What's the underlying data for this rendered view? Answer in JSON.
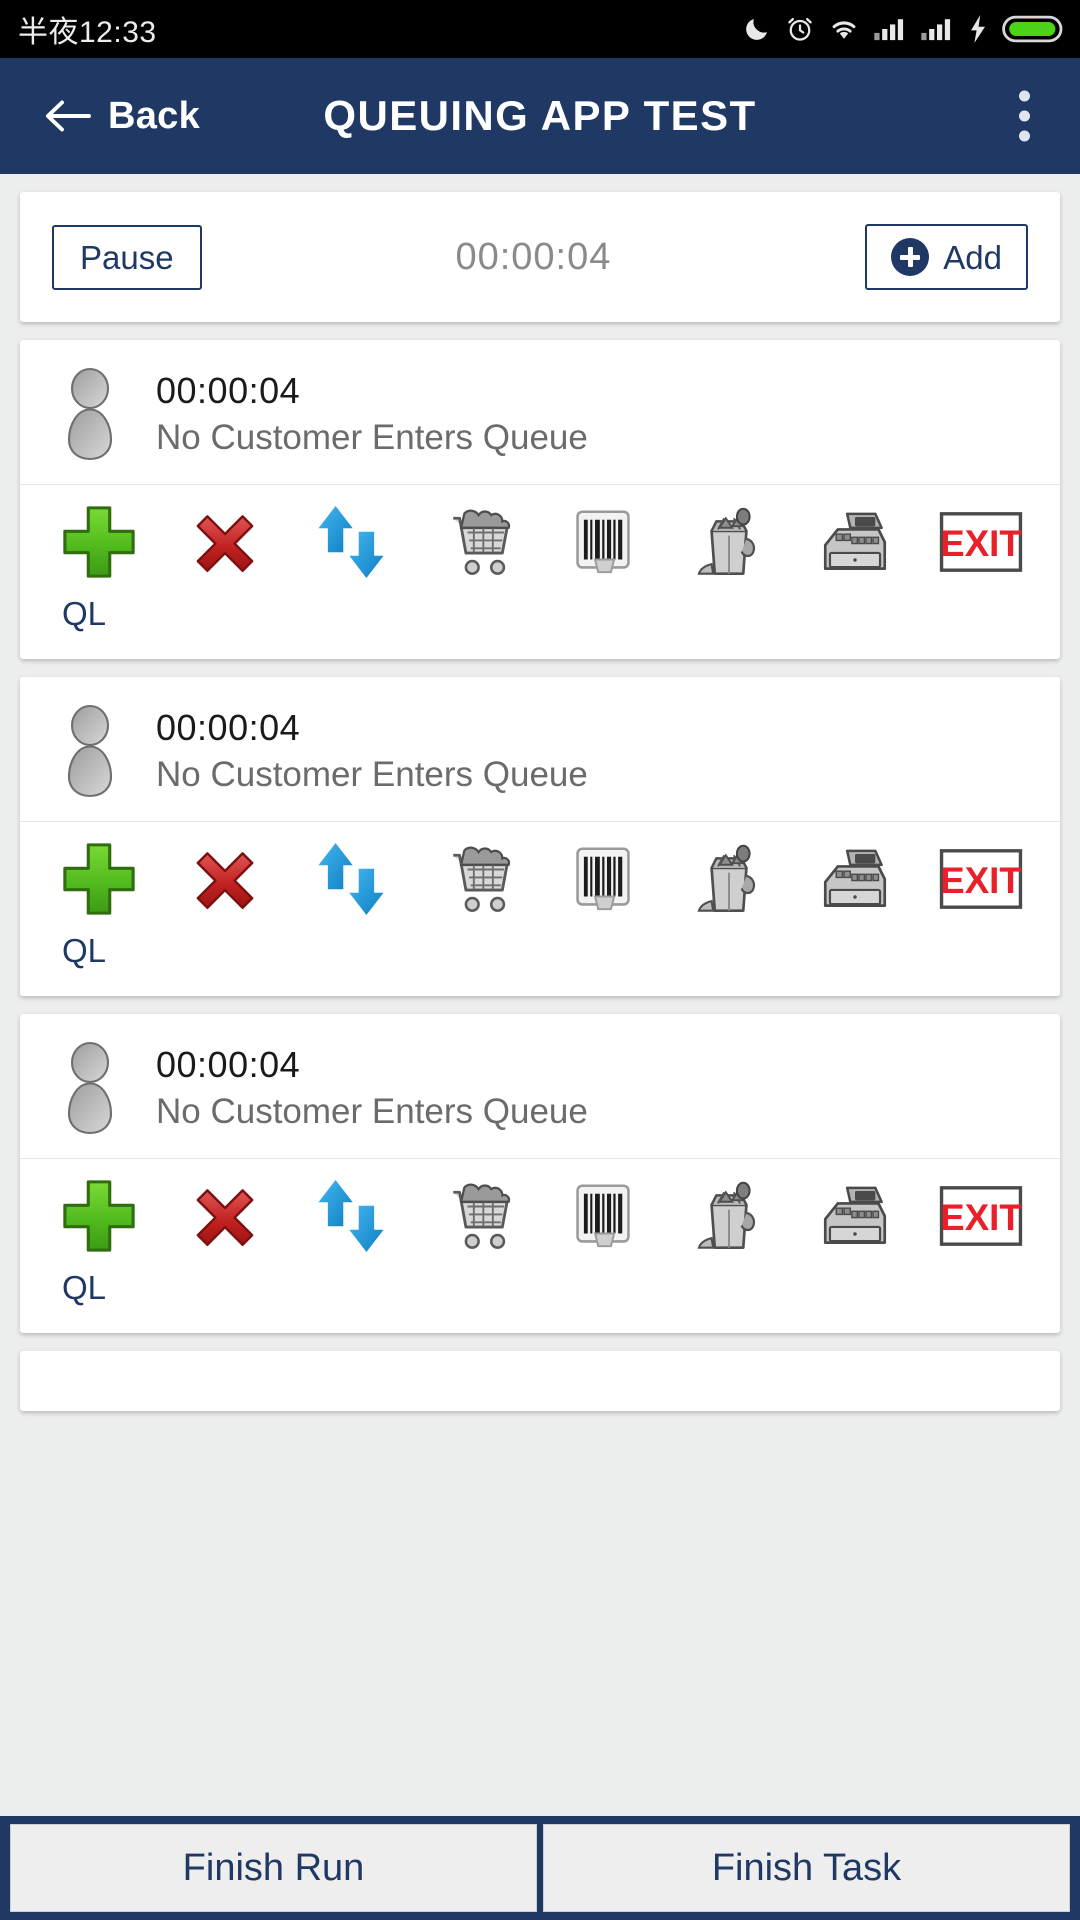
{
  "status_bar": {
    "time": "半夜12:33",
    "icons": [
      "moon-icon",
      "alarm-icon",
      "wifi-icon",
      "signal-icon",
      "signal-icon",
      "charging-bolt-icon",
      "battery-icon"
    ]
  },
  "app_bar": {
    "back_label": "Back",
    "title": "QUEUING APP TEST",
    "overflow_name": "more-options"
  },
  "control_bar": {
    "pause_label": "Pause",
    "timer": "00:00:04",
    "add_label": "Add"
  },
  "queue_cards": [
    {
      "time": "00:00:04",
      "status": "No Customer Enters Queue",
      "ql_label": "QL"
    },
    {
      "time": "00:00:04",
      "status": "No Customer Enters Queue",
      "ql_label": "QL"
    },
    {
      "time": "00:00:04",
      "status": "No Customer Enters Queue",
      "ql_label": "QL"
    }
  ],
  "action_icons": [
    {
      "name": "green-plus-icon",
      "label": "Add Customer"
    },
    {
      "name": "red-x-icon",
      "label": "Remove Customer"
    },
    {
      "name": "blue-up-down-arrows-icon",
      "label": "Swap"
    },
    {
      "name": "shopping-cart-icon",
      "label": "Cart"
    },
    {
      "name": "barcode-icon",
      "label": "Scan"
    },
    {
      "name": "grocery-bag-icon",
      "label": "Bagging"
    },
    {
      "name": "cash-register-icon",
      "label": "Register"
    },
    {
      "name": "exit-sign-icon",
      "label": "EXIT"
    }
  ],
  "exit_sign_text": "EXIT",
  "bottom_bar": {
    "finish_run_label": "Finish Run",
    "finish_task_label": "Finish Task"
  },
  "colors": {
    "navy": "#1f3864",
    "page_bg": "#eceded",
    "card_bg": "#ffffff",
    "status_text": "#6b6b6b",
    "timer_text": "#8a8a8a",
    "green": "#5cc02c",
    "red": "#cc2b2b",
    "blue": "#1f9ae0",
    "exit_red": "#e8202a"
  }
}
